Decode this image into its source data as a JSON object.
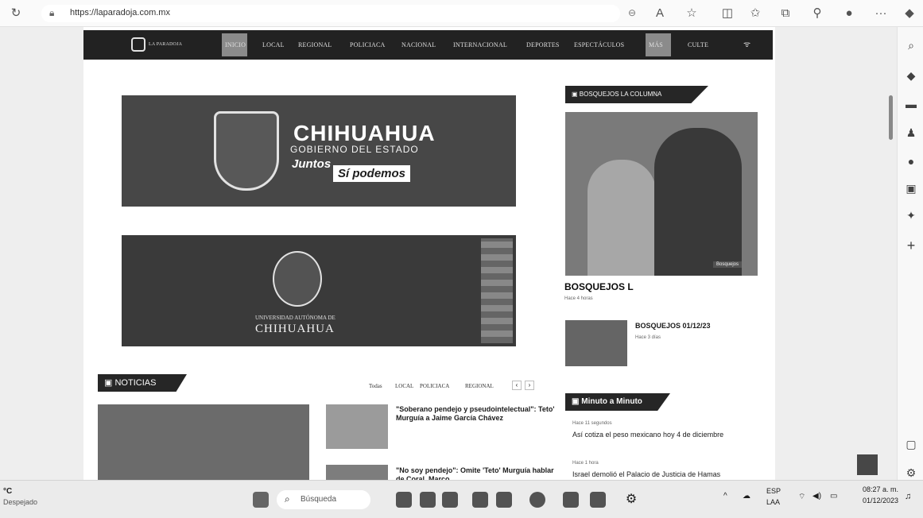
{
  "browser": {
    "url": "https://laparadoja.com.mx",
    "icons": [
      "refresh-icon",
      "lock-icon",
      "zoom-icon",
      "read-aloud-icon",
      "favorite-star-icon",
      "split-screen-icon",
      "favorites-icon",
      "collections-icon",
      "extensions-icon",
      "profile-icon",
      "more-icon",
      "copilot-icon"
    ]
  },
  "sidebar": {
    "icons": [
      "search-icon",
      "tag-icon",
      "briefcase-icon",
      "people-icon",
      "office-icon",
      "outlook-icon",
      "games-icon",
      "add-icon",
      "layout-icon",
      "settings-icon"
    ]
  },
  "site": {
    "logo_text": "LA PARADOJA",
    "nav": [
      "INICIO",
      "LOCAL",
      "REGIONAL",
      "POLICIACA",
      "NACIONAL",
      "INTERNACIONAL",
      "DEPORTES",
      "ESPECTÁCULOS",
      "MÁS",
      "CULTE"
    ],
    "banner1": {
      "title": "CHIHUAHUA",
      "subtitle": "GOBIERNO DEL ESTADO",
      "slogan_a": "Juntos",
      "slogan_b": "Sí podemos"
    },
    "banner2": {
      "title": "CHIHUAHUA",
      "subtitle": "UNIVERSIDAD AUTÓNOMA DE"
    },
    "noticias": {
      "label": "NOTICIAS",
      "filters": [
        "Todas",
        "LOCAL",
        "POLICIACA",
        "REGIONAL"
      ],
      "items": [
        {
          "title": "\"Soberano pendejo y pseudointelectual\": Teto' Murguía a Jaime García Chávez"
        },
        {
          "title": "\"No soy pendejo\": Omite 'Teto' Murguía hablar de Coral, Marco"
        }
      ]
    },
    "bosquejos": {
      "label": "BOSQUEJOS LA COLUMNA",
      "main_title": "BOSQUEJOS L",
      "main_time": "Hace 4 horas",
      "badge": "Bosquejos",
      "item_title": "BOSQUEJOS 01/12/23",
      "item_time": "Hace 3 días"
    },
    "minuto": {
      "label": "Minuto a Minuto",
      "items": [
        {
          "time": "Hace 11 segundos",
          "title": "Así cotiza el peso mexicano hoy 4 de diciembre"
        },
        {
          "time": "Hace 1 hora",
          "title": "Israel demolió el Palacio de Justicia de Hamas"
        }
      ]
    }
  },
  "taskbar": {
    "weather_temp": "°C",
    "weather_desc": "Despejado",
    "search_placeholder": "Búsqueda",
    "lang_top": "ESP",
    "lang_bottom": "LAA",
    "time": "08:27 a. m.",
    "date": "01/12/2023"
  }
}
